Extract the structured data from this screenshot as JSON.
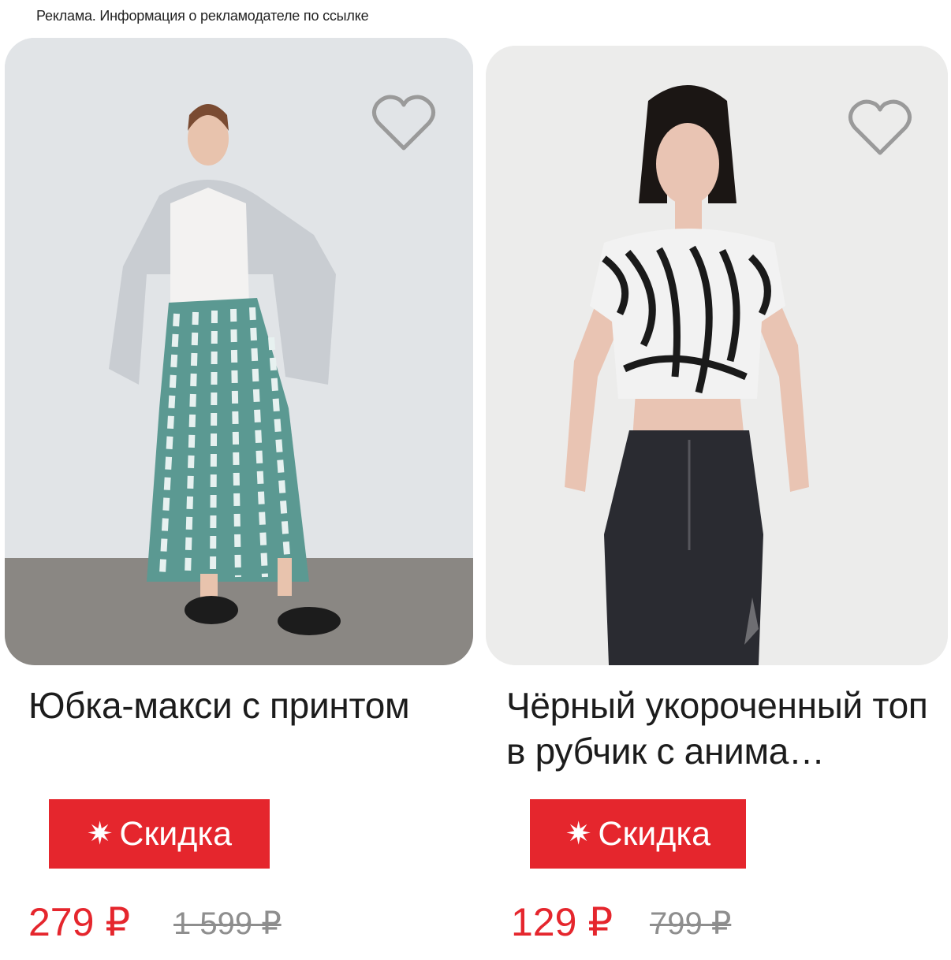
{
  "ad_notice": "Реклама. Информация о рекламодателе по ссылке",
  "products": [
    {
      "title": "Юбка-макси с принтом",
      "badge_icon": "star-burst-icon",
      "badge_label": "Скидка",
      "price": "279 ₽",
      "old_price": "1 599 ₽",
      "favorite_icon": "heart-outline-icon"
    },
    {
      "title": "Чёрный укороченный топ в рубчик с анима…",
      "badge_icon": "star-burst-icon",
      "badge_label": "Скидка",
      "price": "129 ₽",
      "old_price": "799 ₽",
      "favorite_icon": "heart-outline-icon"
    }
  ],
  "colors": {
    "accent_red": "#e5262d",
    "old_price_gray": "#8e8e8e",
    "heart_outline": "#9a9a9a"
  }
}
